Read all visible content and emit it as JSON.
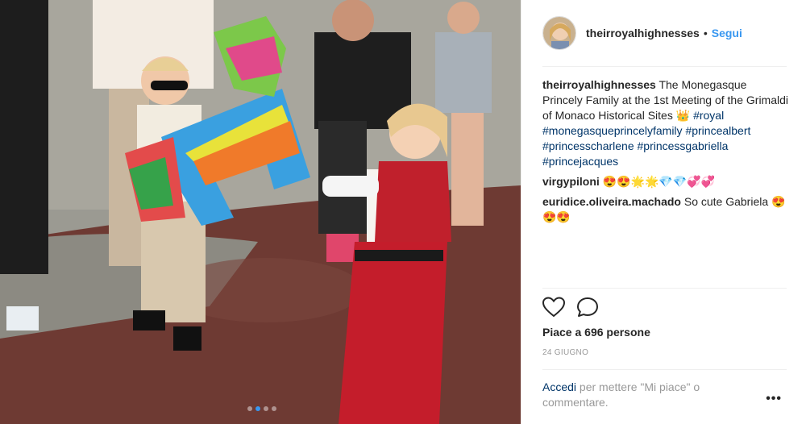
{
  "post": {
    "username": "theirroyalhighnesses",
    "separator": "•",
    "follow_label": "Segui",
    "caption": {
      "author": "theirroyalhighnesses",
      "text": " The Monegasque Princely Family at the 1st Meeting of the Grimaldi of Monaco Historical Sites ",
      "emoji": "👑",
      "hashtags": [
        "#royal",
        "#monegasqueprincelyfamily",
        "#princealbert",
        "#princesscharlene",
        "#princessgabriella",
        "#princejacques"
      ]
    },
    "comments": [
      {
        "author": "virgypiloni",
        "text": " 😍😍🌟🌟💎💎💞💞"
      },
      {
        "author": "euridice.oliveira.machado",
        "text": " So cute Gabriela 😍😍😍"
      }
    ],
    "likes_label": "Piace a 696 persone",
    "date_label": "24 GIUGNO",
    "login_link": "Accedi",
    "login_text": " per mettere \"Mi piace\" o commentare.",
    "more_label": "•••"
  },
  "carousel": {
    "count": 4,
    "active": 1
  },
  "icons": {
    "like": "heart-icon",
    "comment": "comment-icon",
    "more": "more-options-icon"
  },
  "colors": {
    "link": "#003569",
    "follow": "#3897f0",
    "muted": "#999999"
  }
}
